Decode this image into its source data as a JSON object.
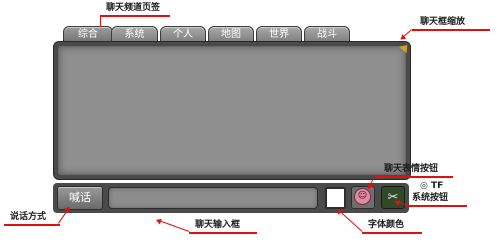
{
  "tabs": [
    {
      "label": "综合"
    },
    {
      "label": "系统"
    },
    {
      "label": "个人"
    },
    {
      "label": "地图"
    },
    {
      "label": "世界"
    },
    {
      "label": "战斗"
    }
  ],
  "bottom": {
    "mode_label": "喊话",
    "input_placeholder": "",
    "emoji_glyph": "☺",
    "action_glyph": "✂"
  },
  "annotations": {
    "tabs": "聊天频道页签",
    "zoom": "聊天框缩放",
    "emoji": "聊天表情按钮",
    "action_line1": "◎ TF",
    "action_line2": "系统按钮",
    "mode": "说话方式",
    "input": "聊天输入框",
    "color": "字体颜色"
  },
  "colors": {
    "annotation": "#e01010",
    "panel": "#8f8f8f",
    "frame": "#4a4a4a",
    "accent": "#c9a227"
  }
}
